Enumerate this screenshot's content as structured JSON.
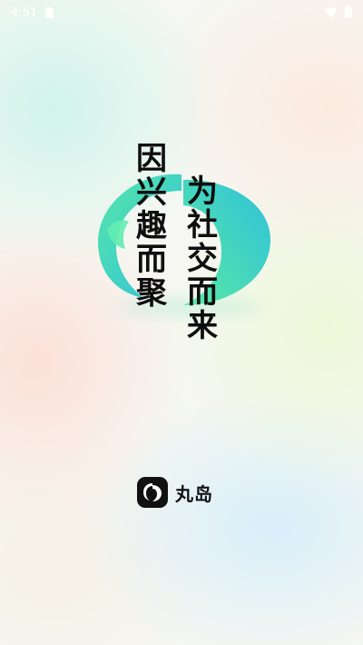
{
  "status_bar": {
    "time": "4:51",
    "left_icons": [
      "sim-card-icon"
    ],
    "right_icons": [
      "wifi-icon",
      "battery-icon"
    ]
  },
  "splash": {
    "slogan_left": [
      "因",
      "兴",
      "趣",
      "而",
      "聚"
    ],
    "slogan_right": [
      "为",
      "社",
      "交",
      "而",
      "来"
    ]
  },
  "brand": {
    "name": "丸岛",
    "icon": "app-logo-icon"
  },
  "colors": {
    "logo_teal": "#35c4d6",
    "logo_green": "#59e6a4",
    "text": "#0e0e0e"
  }
}
